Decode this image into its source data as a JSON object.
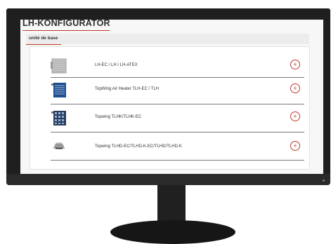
{
  "app": {
    "title": "LH-KONFIGURATOR",
    "accent_color": "#c0392b"
  },
  "section": {
    "label": "unité de base"
  },
  "products": [
    {
      "label": "LH-EC / LH / LH-ATEX",
      "icon": "grille-heater-icon",
      "action": "+"
    },
    {
      "label": "TopWing Air Heater TLH-EC / TLH",
      "icon": "blue-coil-heater-icon",
      "action": "+"
    },
    {
      "label": "Topwing TLHK/TLHK-EC",
      "icon": "coil-grid-heater-icon",
      "action": "+"
    },
    {
      "label": "Topwing TLHD-EC/TLHD-K-EC/TLHD/TLHD-K",
      "icon": "ceiling-unit-icon",
      "action": "+"
    }
  ]
}
